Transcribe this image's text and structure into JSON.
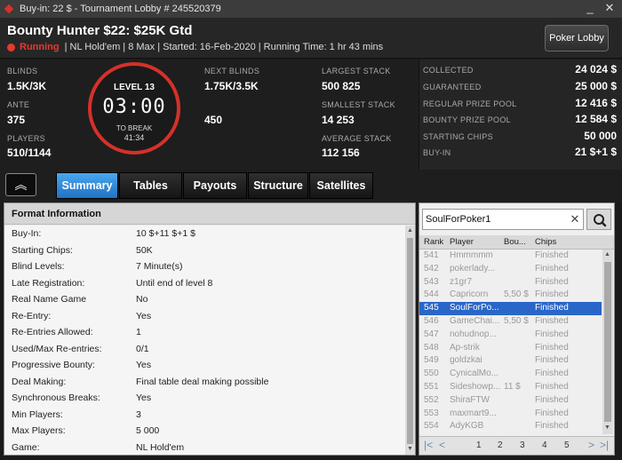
{
  "window": {
    "title": "Buy-in: 22 $ - Tournament Lobby # 245520379",
    "minimize": "_",
    "close": "✕"
  },
  "header": {
    "title": "Bounty Hunter $22: $25K Gtd",
    "status": "Running",
    "details": "| NL Hold'em | 8 Max | Started: 16-Feb-2020 | Running Time: 1 hr  43 mins",
    "lobby_button": "Poker Lobby",
    "status_color": "#e23a30"
  },
  "stats": {
    "blinds_label": "BLINDS",
    "blinds": "1.5K/3K",
    "ante_label": "ANTE",
    "ante": "375",
    "players_label": "PLAYERS",
    "players": "510/1144",
    "level": "LEVEL 13",
    "clock": "03:00",
    "to_break_label": "TO BREAK",
    "to_break": "41:34",
    "next_blinds_label": "NEXT BLINDS",
    "next_blinds": "1.75K/3.5K",
    "next_ante": "450",
    "largest_stack_label": "LARGEST STACK",
    "largest_stack": "500 825",
    "smallest_stack_label": "SMALLEST STACK",
    "smallest_stack": "14 253",
    "average_stack_label": "AVERAGE STACK",
    "average_stack": "112 156"
  },
  "prize": [
    {
      "label": "COLLECTED",
      "value": "24 024 $"
    },
    {
      "label": "GUARANTEED",
      "value": "25 000 $"
    },
    {
      "label": "REGULAR PRIZE POOL",
      "value": "12 416 $"
    },
    {
      "label": "BOUNTY PRIZE POOL",
      "value": "12 584 $"
    },
    {
      "label": "STARTING CHIPS",
      "value": "50 000"
    },
    {
      "label": "BUY-IN",
      "value": "21 $+1 $"
    }
  ],
  "tabs": [
    {
      "label": "Summary",
      "active": true
    },
    {
      "label": "Tables",
      "active": false
    },
    {
      "label": "Payouts",
      "active": false
    },
    {
      "label": "Structure",
      "active": false
    },
    {
      "label": "Satellites",
      "active": false
    }
  ],
  "collapse_icon": "︽",
  "format": {
    "heading": "Format Information",
    "rows": [
      {
        "key": "Buy-In:",
        "value": "10 $+11 $+1 $"
      },
      {
        "key": "Starting Chips:",
        "value": "50K"
      },
      {
        "key": "Blind Levels:",
        "value": "7 Minute(s)"
      },
      {
        "key": "Late Registration:",
        "value": "Until end of level 8"
      },
      {
        "key": "Real Name Game",
        "value": "No"
      },
      {
        "key": "Re-Entry:",
        "value": "Yes"
      },
      {
        "key": "Re-Entries Allowed:",
        "value": "1"
      },
      {
        "key": "Used/Max Re-entries:",
        "value": "0/1"
      },
      {
        "key": "Progressive Bounty:",
        "value": "Yes"
      },
      {
        "key": "Deal Making:",
        "value": "Final table deal making possible"
      },
      {
        "key": "Synchronous Breaks:",
        "value": "Yes"
      },
      {
        "key": "Min Players:",
        "value": "3"
      },
      {
        "key": "Max Players:",
        "value": "5 000"
      },
      {
        "key": "Game:",
        "value": "NL Hold'em"
      }
    ]
  },
  "search": {
    "value": "SoulForPoker1",
    "clear": "✕"
  },
  "player_table": {
    "headers": [
      "Rank",
      "Player",
      "Bou...",
      "Chips"
    ],
    "rows": [
      {
        "rank": "541",
        "player": "Hmmmmm",
        "bounty": "",
        "chips": "Finished",
        "selected": false
      },
      {
        "rank": "542",
        "player": "pokerlady...",
        "bounty": "",
        "chips": "Finished",
        "selected": false
      },
      {
        "rank": "543",
        "player": "z1gr7",
        "bounty": "",
        "chips": "Finished",
        "selected": false
      },
      {
        "rank": "544",
        "player": "Capricorn",
        "bounty": "5,50 $",
        "chips": "Finished",
        "selected": false
      },
      {
        "rank": "545",
        "player": "SoulForPo...",
        "bounty": "",
        "chips": "Finished",
        "selected": true
      },
      {
        "rank": "546",
        "player": "GameChai...",
        "bounty": "5,50 $",
        "chips": "Finished",
        "selected": false
      },
      {
        "rank": "547",
        "player": "nohudnop...",
        "bounty": "",
        "chips": "Finished",
        "selected": false
      },
      {
        "rank": "548",
        "player": "Ap-strik",
        "bounty": "",
        "chips": "Finished",
        "selected": false
      },
      {
        "rank": "549",
        "player": "goldzkai",
        "bounty": "",
        "chips": "Finished",
        "selected": false
      },
      {
        "rank": "550",
        "player": "CynicalMo...",
        "bounty": "",
        "chips": "Finished",
        "selected": false
      },
      {
        "rank": "551",
        "player": "Sideshowp...",
        "bounty": "11 $",
        "chips": "Finished",
        "selected": false
      },
      {
        "rank": "552",
        "player": "ShiraFTW",
        "bounty": "",
        "chips": "Finished",
        "selected": false
      },
      {
        "rank": "553",
        "player": "maxmart9...",
        "bounty": "",
        "chips": "Finished",
        "selected": false
      },
      {
        "rank": "554",
        "player": "AdyKGB",
        "bounty": "",
        "chips": "Finished",
        "selected": false
      }
    ]
  },
  "pager": {
    "first": "|<",
    "prev": "<",
    "pages": [
      "1",
      "2",
      "3",
      "4",
      "5"
    ],
    "next": ">",
    "last": ">|"
  },
  "colors": {
    "accent": "#2a7fd4",
    "selected_row": "#2a66c8",
    "ring": "#d4312a"
  }
}
